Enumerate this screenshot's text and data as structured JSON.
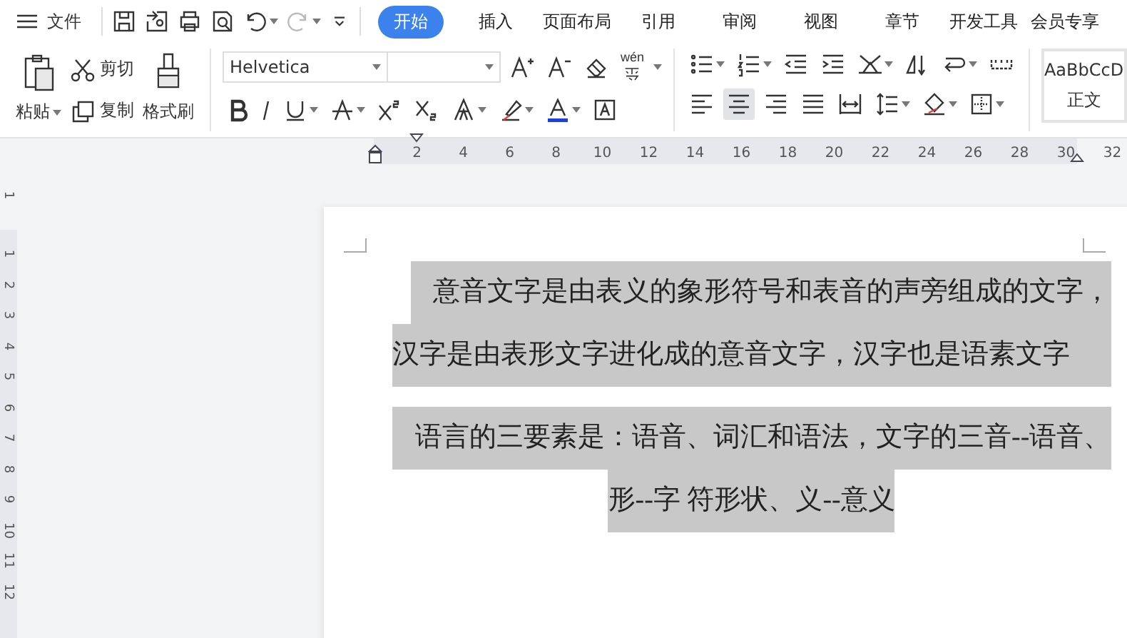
{
  "menu": {
    "label": "文件"
  },
  "tabs": [
    {
      "label": "开始",
      "selected": true
    },
    {
      "label": "插入",
      "selected": false
    },
    {
      "label": "页面布局",
      "selected": false
    },
    {
      "label": "引用",
      "selected": false
    },
    {
      "label": "审阅",
      "selected": false
    },
    {
      "label": "视图",
      "selected": false
    },
    {
      "label": "章节",
      "selected": false
    },
    {
      "label": "开发工具",
      "selected": false
    },
    {
      "label": "会员专享",
      "selected": false
    }
  ],
  "clipboard": {
    "paste": "粘贴",
    "cut": "剪切",
    "copy": "复制",
    "format_painter": "格式刷"
  },
  "font": {
    "name": "Helvetica"
  },
  "pinyin_label": "wén",
  "align_buttons": [
    {
      "selected": false
    },
    {
      "selected": true
    },
    {
      "selected": false
    },
    {
      "selected": false
    },
    {
      "selected": false
    }
  ],
  "style_gallery": {
    "preview": "AaBbCcD",
    "name": "正文"
  },
  "ruler": {
    "labels": [
      "2",
      "4",
      "6",
      "8",
      "10",
      "12",
      "14",
      "16",
      "18",
      "20",
      "22",
      "24",
      "26",
      "28",
      "30",
      "32"
    ]
  },
  "vertical_ruler": {
    "top_label": "1",
    "labels": [
      "1",
      "2",
      "3",
      "4",
      "5",
      "6",
      "7",
      "8",
      "9",
      "10",
      "11",
      "12"
    ]
  },
  "document": {
    "paragraphs": [
      {
        "selected": true,
        "lines": [
          "意音文字是由表义的象形符号和表音的声旁组成的文字，",
          "汉字是由表形文字进化成的意音文字，汉字也是语素文字"
        ]
      },
      {
        "selected": true,
        "lines": [
          "语言的三要素是：语音、词汇和语法，文字的三音--语音、",
          "形--字  符形状、义--意义"
        ]
      }
    ]
  }
}
